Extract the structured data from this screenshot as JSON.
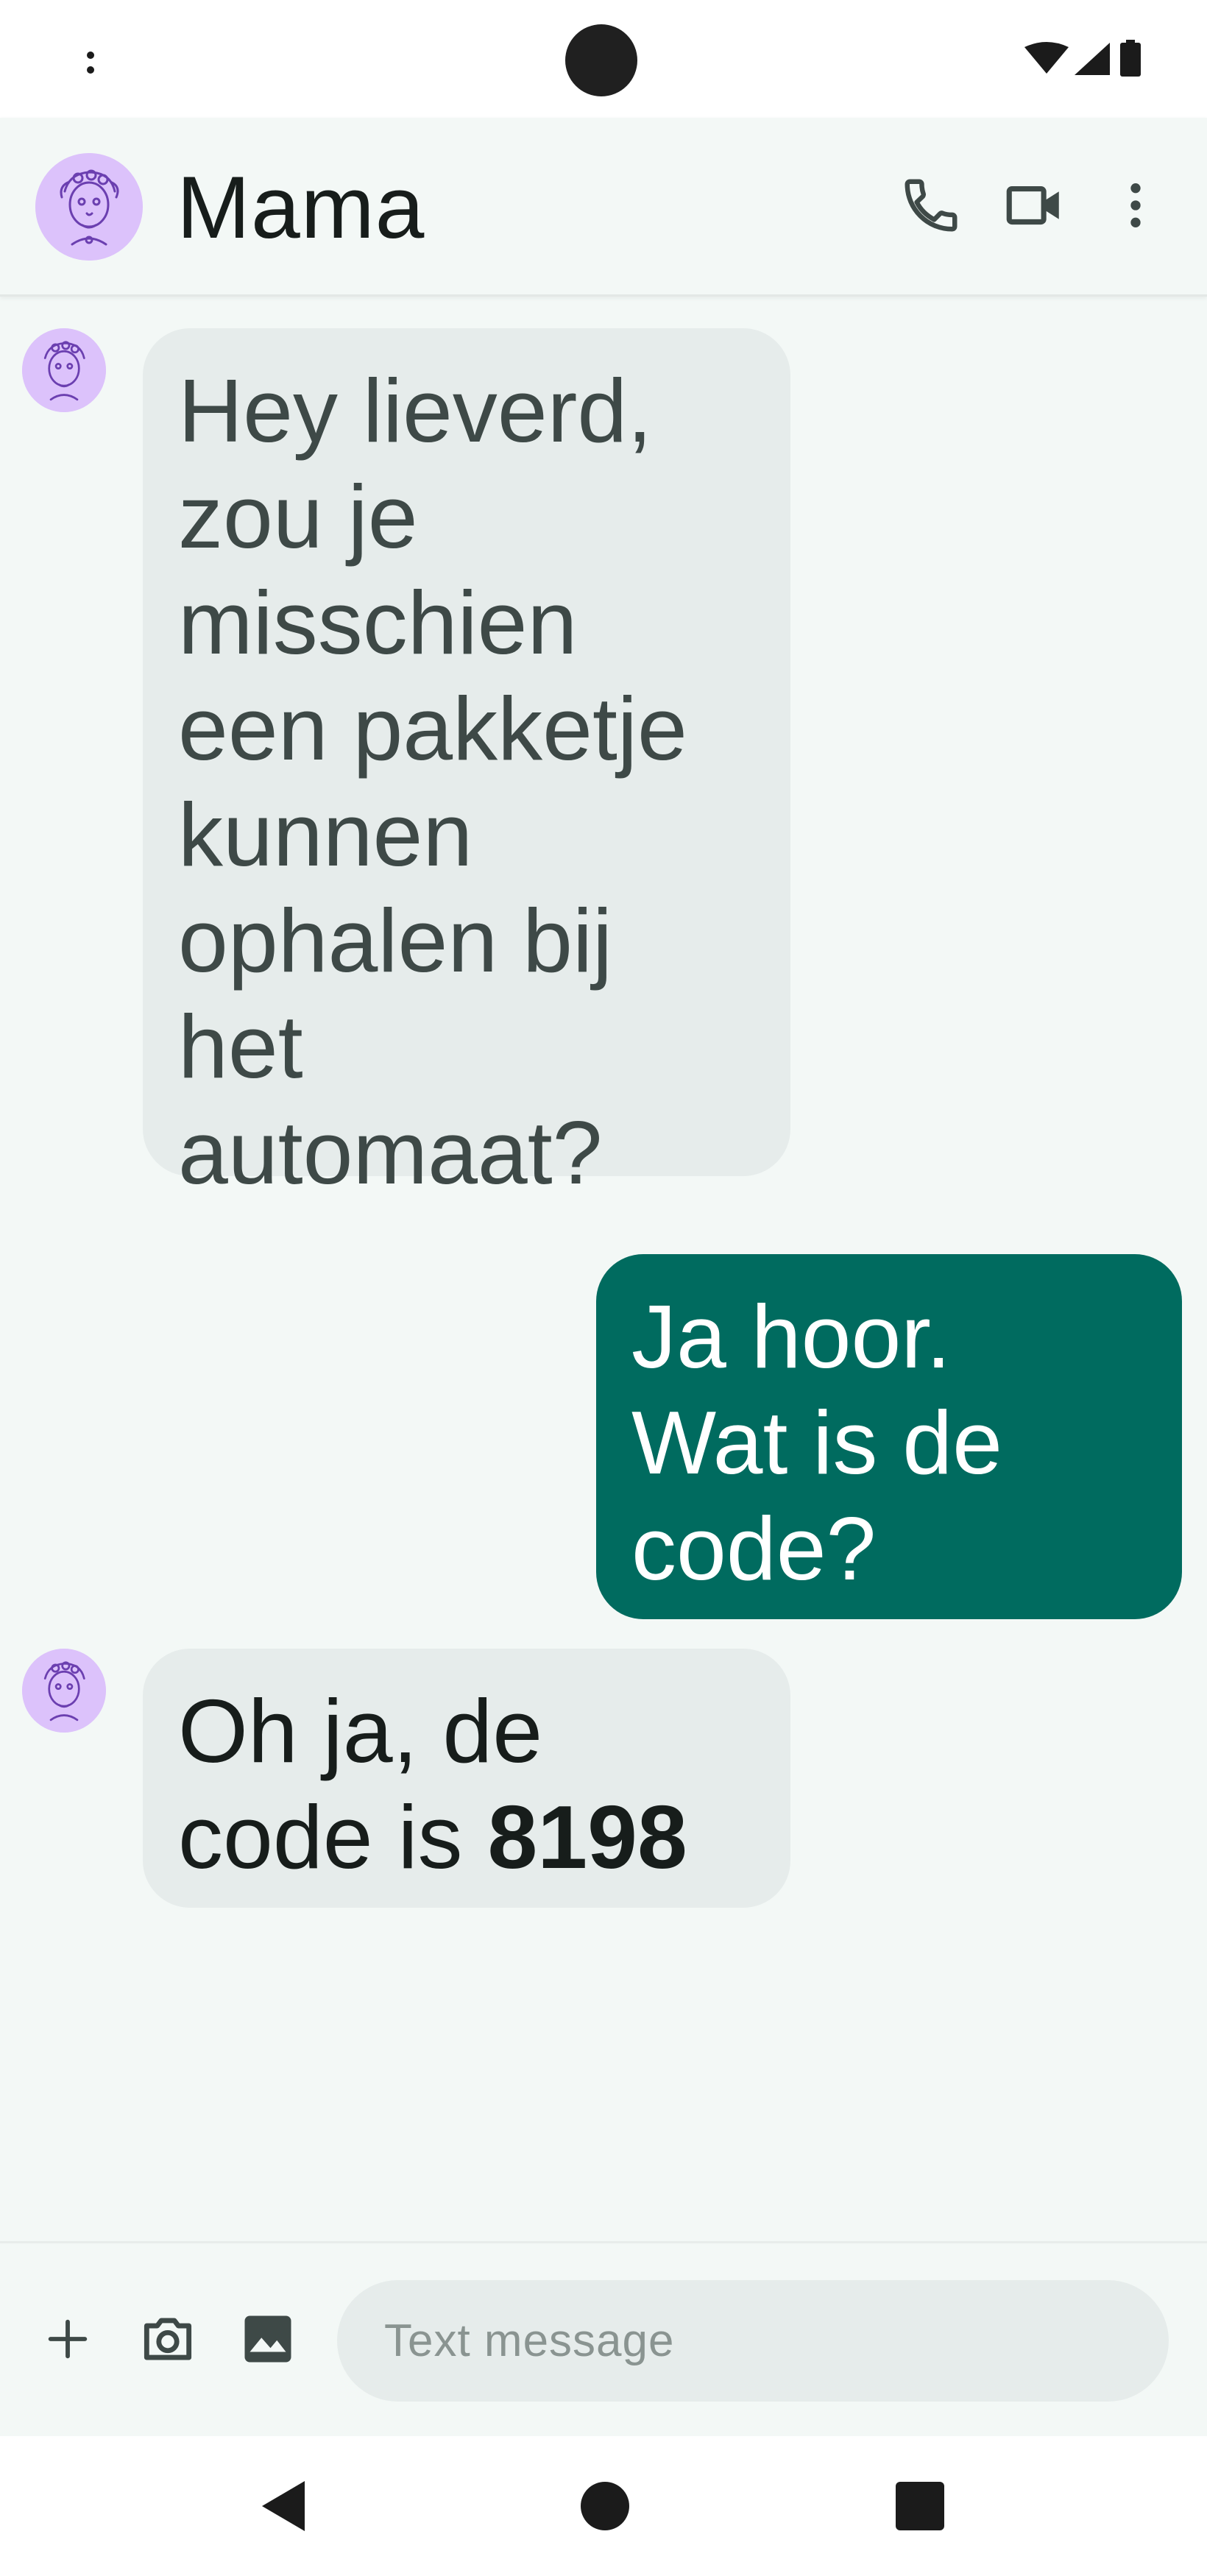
{
  "status_bar": {
    "icons": [
      "overflow-dots-icon",
      "camera-cutout",
      "wifi-icon",
      "cell-signal-icon",
      "battery-icon"
    ]
  },
  "app_bar": {
    "contact_name": "Mama",
    "avatar_icon": "avatar-illustration",
    "actions": [
      "phone-icon",
      "video-call-icon",
      "more-vert-icon"
    ]
  },
  "messages": [
    {
      "direction": "incoming",
      "lines": [
        "Hey lieverd,",
        "zou je",
        "misschien",
        "een pakketje",
        "kunnen",
        "ophalen bij",
        "het",
        "automaat?"
      ]
    },
    {
      "direction": "outgoing",
      "lines": [
        "Ja hoor.",
        "Wat is de",
        "code?"
      ]
    },
    {
      "direction": "incoming",
      "line1": "Oh ja, de",
      "line2_prefix": "code is ",
      "line2_bold": "8198"
    }
  ],
  "composer": {
    "placeholder": "Text message",
    "buttons": [
      "add-icon",
      "camera-icon",
      "gallery-icon"
    ]
  },
  "nav_bar": {
    "buttons": [
      "back-icon",
      "home-icon",
      "recents-icon"
    ]
  },
  "colors": {
    "background": "#f3f8f6",
    "incoming_bubble": "#e6eceb",
    "outgoing_bubble": "#006b5f",
    "avatar": "#dcc2fb"
  }
}
